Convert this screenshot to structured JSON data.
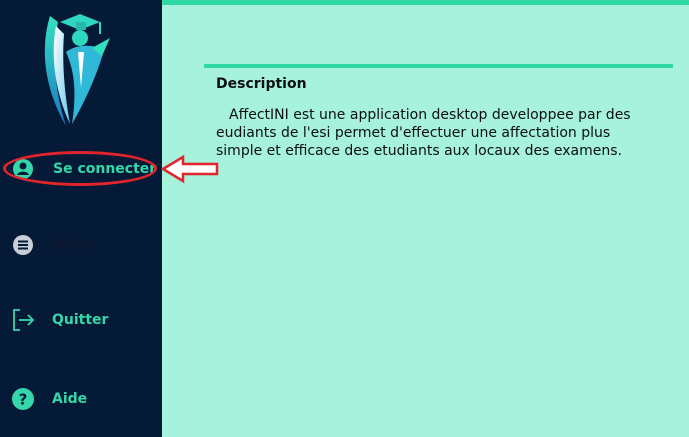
{
  "sidebar": {
    "items": [
      {
        "label": "Se connecter",
        "icon": "user-circle-icon"
      },
      {
        "label": "Menu",
        "icon": "menu-icon"
      },
      {
        "label": "Quitter",
        "icon": "logout-icon"
      },
      {
        "label": "Aide",
        "icon": "help-icon"
      }
    ]
  },
  "main": {
    "description": {
      "title": "Description",
      "text": "AffectINI est une application desktop developpee par des eudiants de l'esi permet d'effectuer une affectation plus simple et efficace des etudiants aux locaux des examens."
    }
  },
  "colors": {
    "sidebar_bg": "#051a36",
    "main_bg": "#a6f2da",
    "accent": "#2ed9a6",
    "annotation_red": "#e2252b"
  }
}
